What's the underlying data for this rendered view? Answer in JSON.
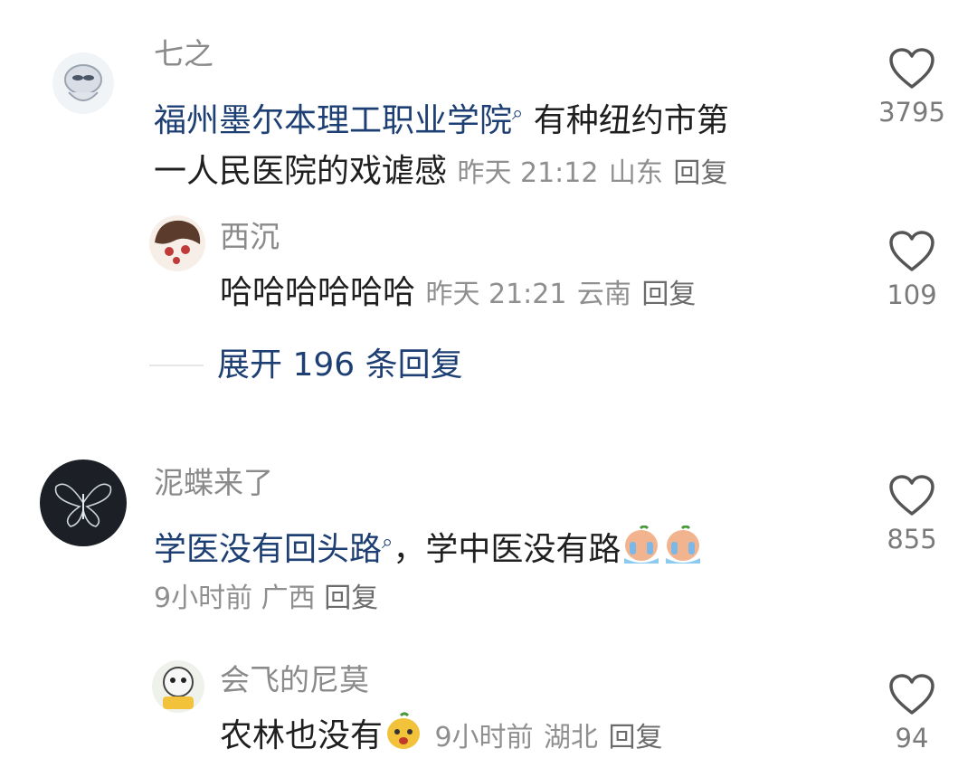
{
  "comments": [
    {
      "user": "七之",
      "link_text": "福州墨尔本理工职业学院",
      "text_line1_rest": " 有种纽约市第",
      "text_line2": "一人民医院的戏谑感",
      "time": "昨天 21:12",
      "location": "山东",
      "reply_label": "回复",
      "likes": "3795",
      "replies": [
        {
          "user": "西沉",
          "text": "哈哈哈哈哈哈",
          "time": "昨天 21:21",
          "location": "云南",
          "reply_label": "回复",
          "likes": "109"
        }
      ],
      "expand_label": "展开 196 条回复"
    },
    {
      "user": "泥蝶来了",
      "link_text": "学医没有回头路",
      "text_rest": "，学中医没有路",
      "time": "9小时前",
      "location": "广西",
      "reply_label": "回复",
      "likes": "855",
      "replies": [
        {
          "user": "会飞的尼莫",
          "text": "农林也没有",
          "time": "9小时前",
          "location": "湖北",
          "reply_label": "回复",
          "likes": "94"
        }
      ]
    }
  ],
  "icons": {
    "like": "heart-outline-icon",
    "search_hint": "search-icon",
    "emoji": "crying-emoji-icon"
  },
  "colors": {
    "link": "#1e3f73",
    "meta": "#8f8f8f",
    "name": "#8a8a8a"
  }
}
